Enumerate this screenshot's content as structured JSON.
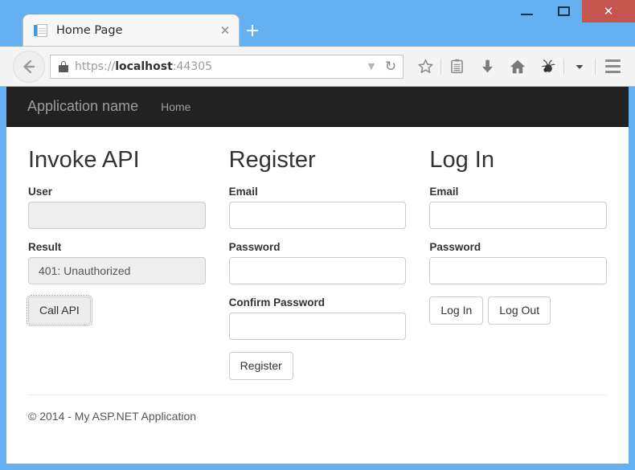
{
  "window": {
    "controls": {
      "minimize_label": "Minimize",
      "maximize_label": "Maximize",
      "close_label": "✕"
    },
    "frame_color": "#64b0f0",
    "close_color": "#c4564f"
  },
  "browser": {
    "tab": {
      "title": "Home Page",
      "close_label": "✕",
      "favicon": "page-favicon"
    },
    "new_tab_label": "+",
    "back_label": "←",
    "address": {
      "scheme": "https://",
      "host": "localhost",
      "port": ":44305",
      "full": "https://localhost:44305",
      "lock": "lock-icon",
      "dropdown_label": "▼",
      "reload_label": "↻"
    },
    "toolbar_icons": [
      {
        "name": "bookmark-star-icon",
        "title": "Bookmark this page"
      },
      {
        "name": "reading-list-icon",
        "title": "Show your bookmarks"
      },
      {
        "name": "downloads-icon",
        "title": "Downloads"
      },
      {
        "name": "home-icon",
        "title": "Home"
      },
      {
        "name": "debug-bug-icon",
        "title": "Extension"
      },
      {
        "name": "overflow-chevron-icon",
        "title": "More"
      }
    ],
    "menu_label": "Open menu"
  },
  "navbar": {
    "brand": "Application name",
    "links": [
      {
        "label": "Home"
      }
    ]
  },
  "columns": [
    {
      "id": "invoke-api",
      "heading": "Invoke API",
      "fields": [
        {
          "id": "user",
          "label": "User",
          "value": "",
          "placeholder": "",
          "readonly": true
        },
        {
          "id": "result",
          "label": "Result",
          "value": "401: Unauthorized",
          "placeholder": "",
          "readonly": true
        }
      ],
      "buttons": [
        {
          "id": "call-api",
          "label": "Call API",
          "focused": true
        }
      ]
    },
    {
      "id": "register",
      "heading": "Register",
      "fields": [
        {
          "id": "register-email",
          "label": "Email",
          "value": "",
          "placeholder": "",
          "readonly": false
        },
        {
          "id": "register-password",
          "label": "Password",
          "value": "",
          "placeholder": "",
          "readonly": false
        },
        {
          "id": "register-confirm-password",
          "label": "Confirm Password",
          "value": "",
          "placeholder": "",
          "readonly": false
        }
      ],
      "buttons": [
        {
          "id": "register",
          "label": "Register",
          "focused": false
        }
      ]
    },
    {
      "id": "log-in",
      "heading": "Log In",
      "fields": [
        {
          "id": "login-email",
          "label": "Email",
          "value": "",
          "placeholder": "",
          "readonly": false
        },
        {
          "id": "login-password",
          "label": "Password",
          "value": "",
          "placeholder": "",
          "readonly": false
        }
      ],
      "buttons": [
        {
          "id": "log-in",
          "label": "Log In",
          "focused": false
        },
        {
          "id": "log-out",
          "label": "Log Out",
          "focused": false
        }
      ]
    }
  ],
  "footer": {
    "text": "© 2014 - My ASP.NET Application"
  }
}
